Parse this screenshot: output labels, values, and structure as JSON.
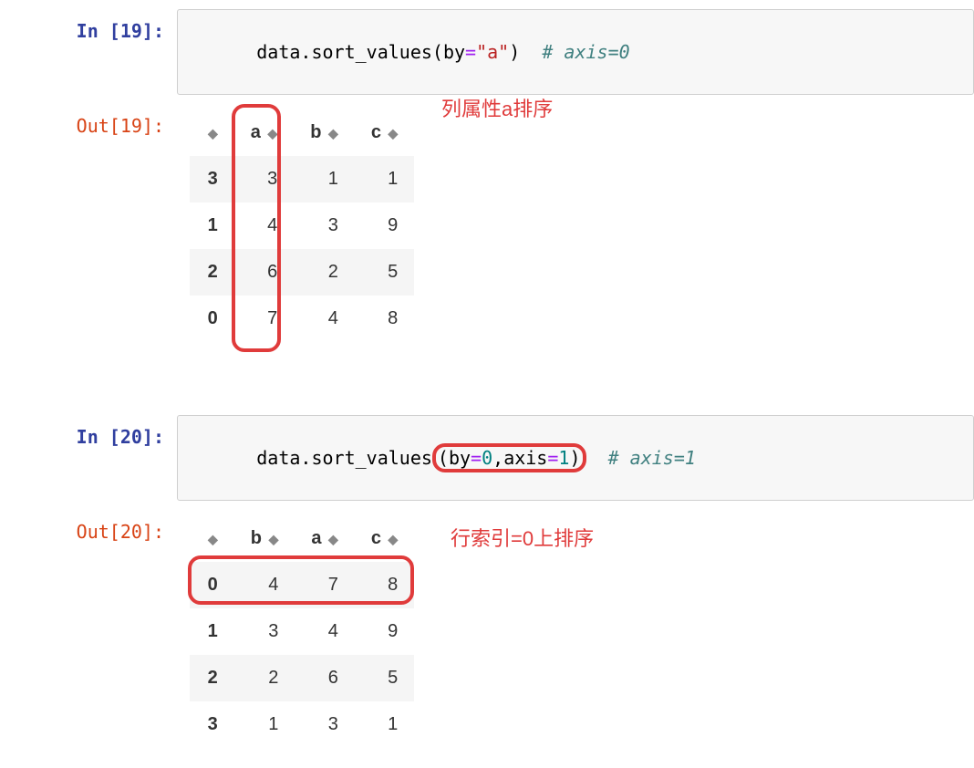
{
  "cells": {
    "in19": {
      "prompt": "In [19]:",
      "code_prefix": "data.sort_values(by",
      "eq": "=",
      "str_val": "\"a\"",
      "paren_close": ")",
      "comment": "# axis=0"
    },
    "out19": {
      "prompt": "Out[19]:",
      "annotation": "列属性a排序"
    },
    "in20": {
      "prompt": "In [20]:",
      "code_prefix": "data.sort_values",
      "inner_open": "(",
      "by_kw": "by",
      "eq1": "=",
      "zero": "0",
      "comma": ",",
      "axis_kw": "axis",
      "eq2": "=",
      "one": "1",
      "inner_close": ")",
      "comment": "# axis=1"
    },
    "out20": {
      "prompt": "Out[20]:",
      "annotation": "行索引=0上排序"
    }
  },
  "table19": {
    "headers": [
      "",
      "a",
      "b",
      "c"
    ],
    "rows": [
      {
        "idx": "3",
        "vals": [
          "3",
          "1",
          "1"
        ]
      },
      {
        "idx": "1",
        "vals": [
          "4",
          "3",
          "9"
        ]
      },
      {
        "idx": "2",
        "vals": [
          "6",
          "2",
          "5"
        ]
      },
      {
        "idx": "0",
        "vals": [
          "7",
          "4",
          "8"
        ]
      }
    ]
  },
  "table20": {
    "headers": [
      "",
      "b",
      "a",
      "c"
    ],
    "rows": [
      {
        "idx": "0",
        "vals": [
          "4",
          "7",
          "8"
        ]
      },
      {
        "idx": "1",
        "vals": [
          "3",
          "4",
          "9"
        ]
      },
      {
        "idx": "2",
        "vals": [
          "2",
          "6",
          "5"
        ]
      },
      {
        "idx": "3",
        "vals": [
          "1",
          "3",
          "1"
        ]
      }
    ]
  }
}
